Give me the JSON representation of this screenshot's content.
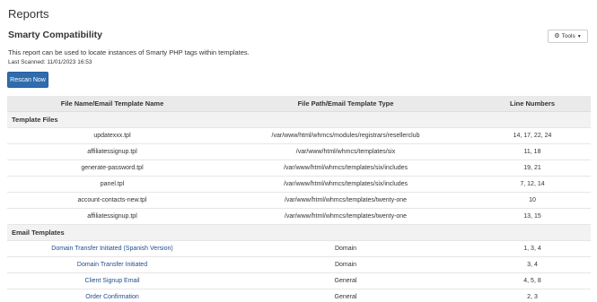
{
  "header": {
    "page_title": "Reports",
    "section_title": "Smarty Compatibility",
    "description": "This report can be used to locate instances of Smarty PHP tags within templates.",
    "last_scanned": "Last Scanned: 11/01/2023 16:53",
    "tools_label": "Tools",
    "tools_icon": "gear-icon",
    "rescan_label": "Rescan Now"
  },
  "colors": {
    "primary_button": "#2f6cae",
    "link": "#1e4d8c",
    "table_header_bg": "#eaeaea"
  },
  "table": {
    "columns": [
      "File Name/Email Template Name",
      "File Path/Email Template Type",
      "Line Numbers"
    ],
    "template_files_label": "Template Files",
    "template_files": [
      {
        "name": "updatexxx.tpl",
        "path": "/var/www/html/whmcs/modules/registrars/resellerclub",
        "lines": "14, 17, 22, 24"
      },
      {
        "name": "affiliatessignup.tpl",
        "path": "/var/www/html/whmcs/templates/six",
        "lines": "11, 18"
      },
      {
        "name": "generate-password.tpl",
        "path": "/var/www/html/whmcs/templates/six/includes",
        "lines": "19, 21"
      },
      {
        "name": "panel.tpl",
        "path": "/var/www/html/whmcs/templates/six/includes",
        "lines": "7, 12, 14"
      },
      {
        "name": "account-contacts-new.tpl",
        "path": "/var/www/html/whmcs/templates/twenty-one",
        "lines": "10"
      },
      {
        "name": "affiliatessignup.tpl",
        "path": "/var/www/html/whmcs/templates/twenty-one",
        "lines": "13, 15"
      }
    ],
    "email_templates_label": "Email Templates",
    "email_templates": [
      {
        "name": "Domain Transfer Initiated (Spanish Version)",
        "type": "Domain",
        "lines": "1, 3, 4"
      },
      {
        "name": "Domain Transfer Initiated",
        "type": "Domain",
        "lines": "3, 4"
      },
      {
        "name": "Client Signup Email",
        "type": "General",
        "lines": "4, 5, 8"
      },
      {
        "name": "Order Confirmation",
        "type": "General",
        "lines": "2, 3"
      }
    ]
  }
}
